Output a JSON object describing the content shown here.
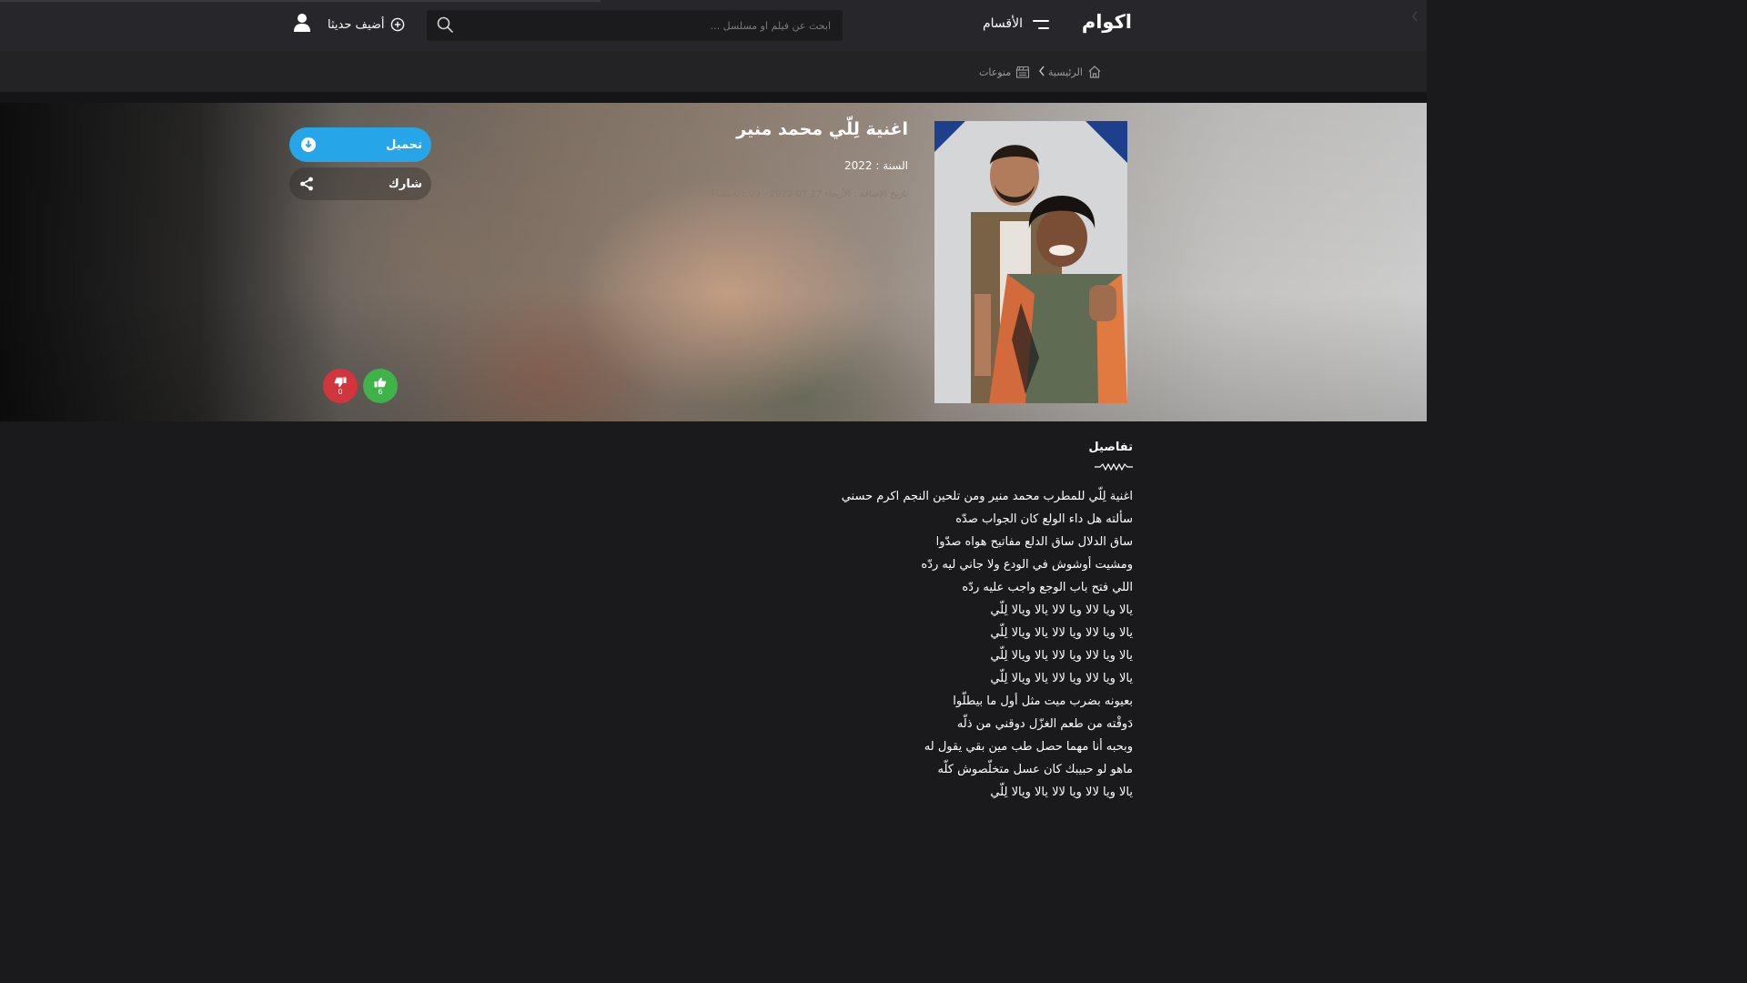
{
  "header": {
    "logo": "اكوام",
    "categories_label": "الأقسام",
    "search_placeholder": "ابحث عن فيلم او مسلسل ...",
    "add_new_label": "أضيف حديثا"
  },
  "breadcrumb": {
    "home": "الرئيسية",
    "category": "منوعات"
  },
  "item": {
    "title": "اغنية لِلّي محمد منير",
    "year": "السنة : 2022",
    "added": "تاريخ الإضافة : الأربعاء 27 07 2022 - 01:09 مساءً",
    "download_label": "تحميل",
    "share_label": "شارك",
    "likes": "6",
    "dislikes": "0"
  },
  "details": {
    "title": "تفاصيل",
    "lines": [
      "اغنية لِلّي للمطرب محمد منير ومن تلحين النجم اكرم حسني",
      "سألته هل داء الولع كان الجواب صدّه",
      "ساق الدلال ساق الدلع مفاتيح هواه صدّوا",
      "ومشيت أوشوش في الودع ولا جاني ليه ردّه",
      "اللي فتح باب الوجع واجب عليه ردّه",
      "يالا ويا لالا ويا لالا يالا ويالا لِلّي",
      "يالا ويا لالا ويا لالا يالا ويالا لِلّي",
      "يالا ويا لالا ويا لالا يالا ويالا لِلّي",
      "يالا ويا لالا ويا لالا يالا ويالا لِلّي",
      "بعيونه بضرب ميت مثل أول ما بيطلّوا",
      "دَوقْته من طعم الغزّل دوقني من ذلّه",
      "وبحبه أنا مهما حصل طب مين بقي يقول له",
      "ماهو لو حبيبك كان عسل متخلّصوش كلّه",
      "يالا ويا لالا ويا لالا يالا ويالا لِلّي"
    ]
  },
  "colors": {
    "header_bg": "#27272b",
    "page_bg": "#1a1a1c",
    "download_button": "#26a6e8",
    "like": "#3fb24a",
    "dislike": "#d2353b"
  }
}
